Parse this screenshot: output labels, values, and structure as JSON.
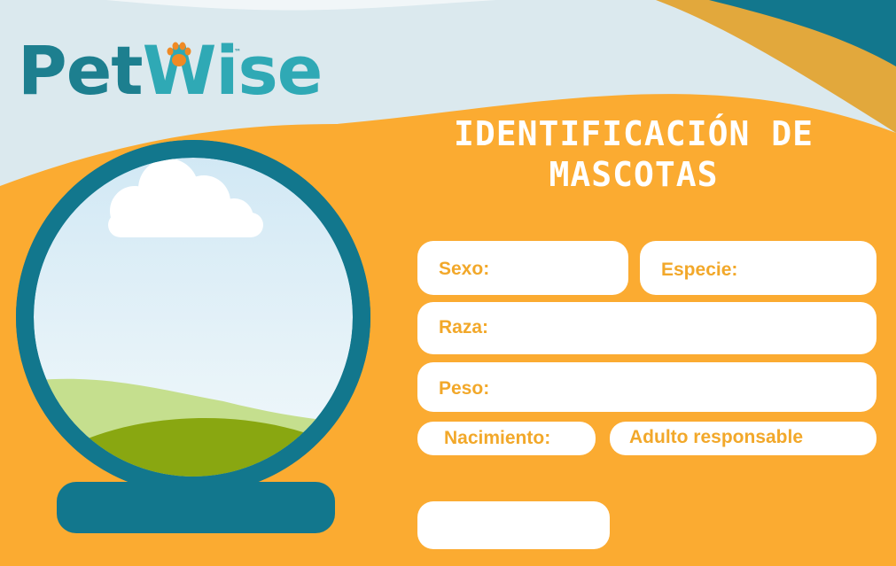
{
  "brand": {
    "name_part1": "Pet",
    "name_part2": "Wise",
    "trademark": "™"
  },
  "title": {
    "line1": "IDENTIFICACIÓN DE",
    "line2": "MASCOTAS"
  },
  "fields": {
    "sexo": "Sexo:",
    "especie": "Especie:",
    "raza": "Raza:",
    "peso": "Peso:",
    "nacimiento": "Nacimiento:",
    "adulto": "Adulto responsable",
    "extra": ""
  },
  "colors": {
    "orange": "#fbab31",
    "teal": "#12778d",
    "light_teal": "#2fa9b5",
    "sky": "#dbe9ee"
  }
}
